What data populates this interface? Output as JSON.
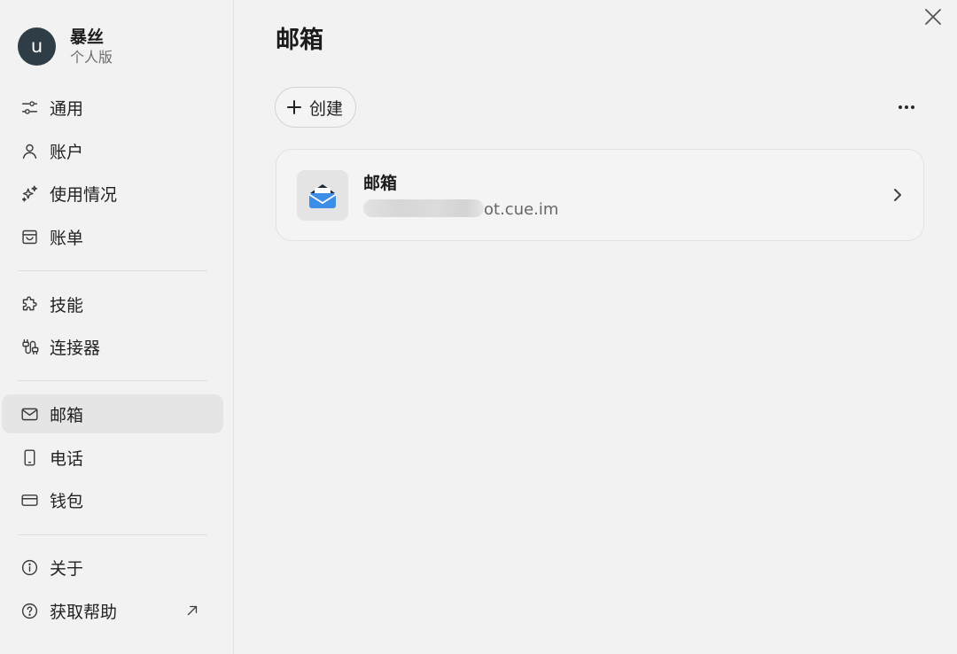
{
  "profile": {
    "avatar_initial": "u",
    "name": "暴丝",
    "plan": "个人版",
    "avatar_color": "#2f3d46"
  },
  "sidebar": {
    "groups": [
      [
        {
          "label": "通用",
          "icon": "sliders-icon"
        },
        {
          "label": "账户",
          "icon": "user-icon"
        },
        {
          "label": "使用情况",
          "icon": "sparkles-icon"
        },
        {
          "label": "账单",
          "icon": "billing-icon"
        }
      ],
      [
        {
          "label": "技能",
          "icon": "puzzle-icon"
        },
        {
          "label": "连接器",
          "icon": "connector-icon"
        }
      ],
      [
        {
          "label": "邮箱",
          "icon": "mail-icon",
          "active": true
        },
        {
          "label": "电话",
          "icon": "phone-icon"
        },
        {
          "label": "钱包",
          "icon": "card-icon"
        }
      ],
      [
        {
          "label": "关于",
          "icon": "info-icon"
        },
        {
          "label": "获取帮助",
          "icon": "help-icon",
          "external": true
        }
      ]
    ]
  },
  "main": {
    "title": "邮箱",
    "create_label": "创建",
    "card": {
      "title": "邮箱",
      "address_visible_suffix": "ot.cue.im",
      "icon": "envelope-open-icon"
    }
  },
  "colors": {
    "background": "#f2f2f2",
    "active_item": "#e5e5e5",
    "mail_blue": "#3d8ee8"
  }
}
